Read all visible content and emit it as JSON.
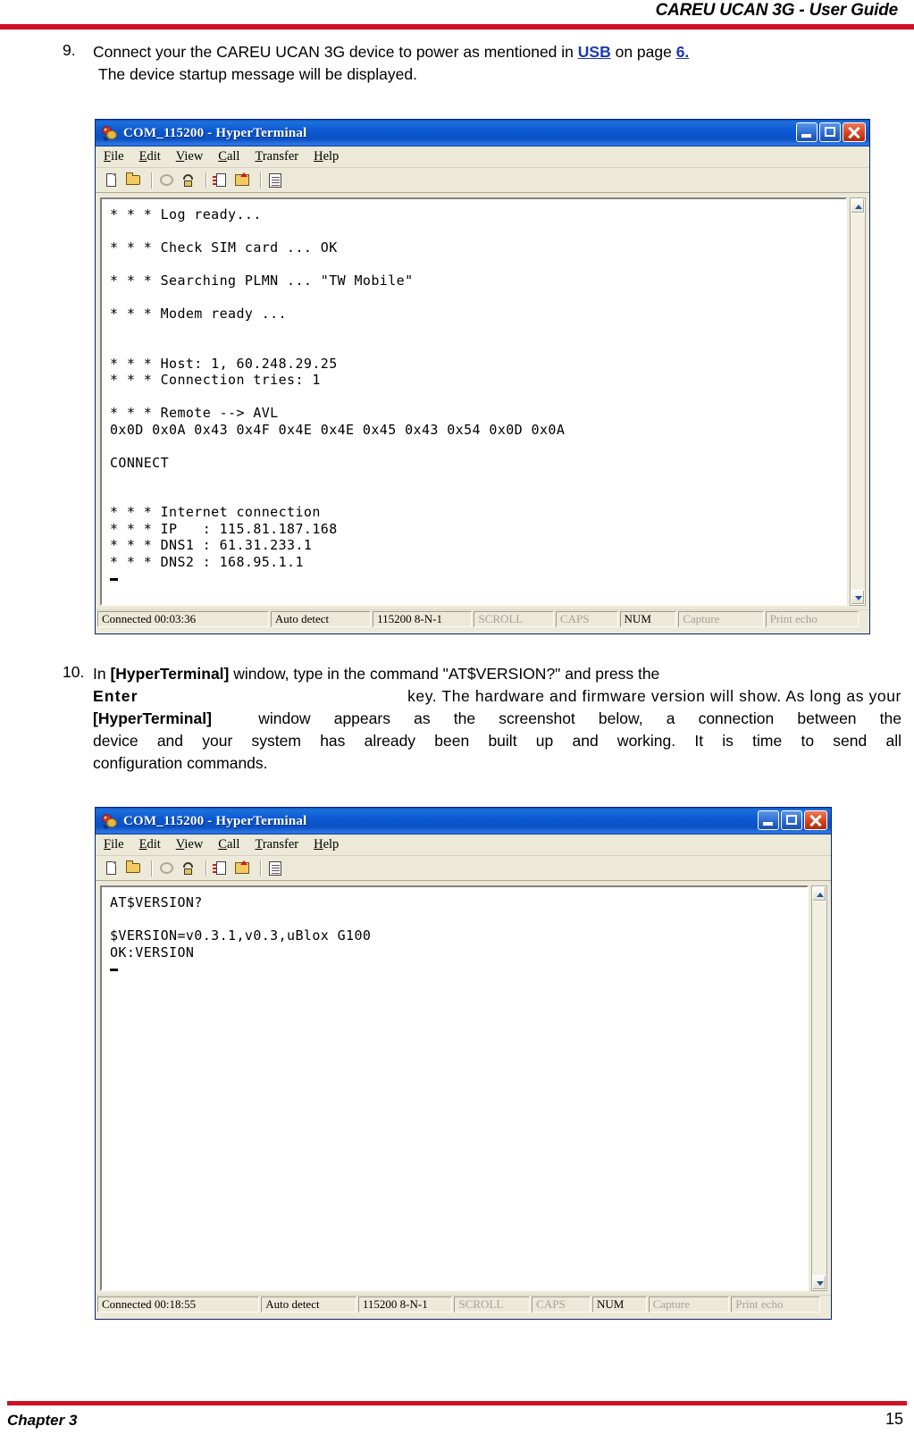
{
  "header": {
    "title": "CAREU UCAN 3G - User Guide",
    "rule_color": "#cf1127"
  },
  "footer": {
    "chapter": "Chapter 3",
    "page_number": "15"
  },
  "steps": [
    {
      "number": "9.",
      "line1_a": "Connect your the CAREU UCAN 3G device to power as mentioned in ",
      "link_usb": "USB",
      "line1_b": " on page ",
      "link_page": "6.",
      "line2": "The  device startup message will be displayed."
    },
    {
      "number": "10.",
      "l1_a": "In ",
      "l1_bold": "[HyperTerminal]",
      "l1_b": " window, type in the command \"AT$VERSION?\" and press the",
      "l2_bold": "Enter",
      "l2_rest": "key. The hardware and firmware version will show. As long as your",
      "l3_bold": "[HyperTerminal]",
      "l3_rest": "window appears as the screenshot below, a connection between the",
      "l4": "device and your system has already been built up and working. It is time to send all",
      "l5": "configuration commands."
    }
  ],
  "hyperterminal_1": {
    "title": "COM_115200 - HyperTerminal",
    "menu": [
      "File",
      "Edit",
      "View",
      "Call",
      "Transfer",
      "Help"
    ],
    "toolbar_icons": [
      "new-connection-icon",
      "open-icon",
      "call-icon",
      "disconnect-icon",
      "send-file-icon",
      "receive-file-icon",
      "properties-icon"
    ],
    "terminal_lines": [
      "* * * Log ready...",
      "",
      "* * * Check SIM card ... OK",
      "",
      "* * * Searching PLMN ... \"TW Mobile\"",
      "",
      "* * * Modem ready ...",
      "",
      "",
      "* * * Host: 1, 60.248.29.25",
      "* * * Connection tries: 1",
      "",
      "* * * Remote --> AVL",
      "0x0D 0x0A 0x43 0x4F 0x4E 0x4E 0x45 0x43 0x54 0x0D 0x0A",
      "",
      "CONNECT",
      "",
      "",
      "* * * Internet connection",
      "* * * IP   : 115.81.187.168",
      "* * * DNS1 : 61.31.233.1",
      "* * * DNS2 : 168.95.1.1"
    ],
    "status": {
      "connected": "Connected 00:03:36",
      "detect": "Auto detect",
      "settings": "115200 8-N-1",
      "scroll": "SCROLL",
      "caps": "CAPS",
      "num": "NUM",
      "capture": "Capture",
      "print_echo": "Print echo"
    }
  },
  "hyperterminal_2": {
    "title": "COM_115200 - HyperTerminal",
    "menu": [
      "File",
      "Edit",
      "View",
      "Call",
      "Transfer",
      "Help"
    ],
    "toolbar_icons": [
      "new-connection-icon",
      "open-icon",
      "call-icon",
      "disconnect-icon",
      "send-file-icon",
      "receive-file-icon",
      "properties-icon"
    ],
    "terminal_lines": [
      "AT$VERSION?",
      "",
      "$VERSION=v0.3.1,v0.3,uBlox G100",
      "OK:VERSION"
    ],
    "status": {
      "connected": "Connected 00:18:55",
      "detect": "Auto detect",
      "settings": "115200 8-N-1",
      "scroll": "SCROLL",
      "caps": "CAPS",
      "num": "NUM",
      "capture": "Capture",
      "print_echo": "Print echo"
    }
  }
}
